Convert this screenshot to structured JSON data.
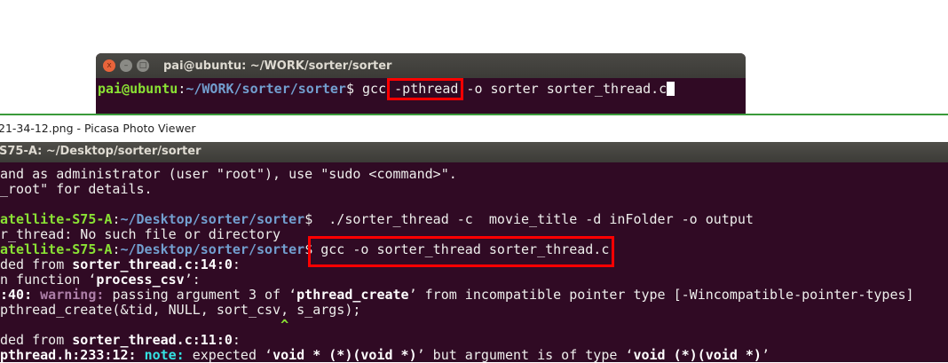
{
  "top_terminal": {
    "title": "pai@ubuntu: ~/WORK/sorter/sorter",
    "buttons": {
      "close": "x",
      "minimize": "–",
      "maximize": "□"
    },
    "prompt_user": "pai@ubuntu",
    "prompt_sep": ":",
    "prompt_path": "~/WORK/sorter/sorter",
    "prompt_end": "$ ",
    "command_pre": "gcc ",
    "command_highlight": "-pthread",
    "command_post": " -o sorter sorter_thread.c"
  },
  "picasa": {
    "title": "21-34-12.png - Picasa Photo Viewer"
  },
  "bottom_terminal": {
    "title": "S75-A: ~/Desktop/sorter/sorter",
    "lines": [
      [
        [
          "n",
          "and as administrator (user \"root\"), use \"sudo <command>\"."
        ]
      ],
      [
        [
          "n",
          "_root\" for details."
        ]
      ],
      [],
      [
        [
          "g",
          "atellite-S75-A"
        ],
        [
          "n",
          ":"
        ],
        [
          "b",
          "~/Desktop/sorter/sorter"
        ],
        [
          "n",
          "$  ./sorter_thread -c  movie_title -d inFolder -o output"
        ]
      ],
      [
        [
          "n",
          "r_thread: No such file or directory"
        ]
      ],
      [
        [
          "g",
          "atellite-S75-A"
        ],
        [
          "n",
          ":"
        ],
        [
          "b",
          "~/Desktop/sorter/sorter"
        ],
        [
          "n",
          "$ gcc -o sorter_thread sorter_thread.c"
        ]
      ],
      [
        [
          "n",
          "ded from "
        ],
        [
          "w",
          "sorter_thread.c:14:0"
        ],
        [
          "n",
          ":"
        ]
      ],
      [
        [
          "n",
          "n function ‘"
        ],
        [
          "w",
          "process_csv"
        ],
        [
          "n",
          "’:"
        ]
      ],
      [
        [
          "w",
          ":40: "
        ],
        [
          "m",
          "warning: "
        ],
        [
          "n",
          "passing argument 3 of ‘"
        ],
        [
          "w",
          "pthread_create"
        ],
        [
          "n",
          "’ from incompatible pointer type [-Wincompatible-pointer-types]"
        ]
      ],
      [
        [
          "n",
          "pthread_create(&tid, NULL, sort_csv, s_args);"
        ]
      ],
      [
        [
          "g",
          "                                   ^"
        ]
      ],
      [
        [
          "n",
          "ded from "
        ],
        [
          "w",
          "sorter_thread.c:11:0"
        ],
        [
          "n",
          ":"
        ]
      ],
      [
        [
          "w",
          "pthread.h:233:12: "
        ],
        [
          "c",
          "note: "
        ],
        [
          "n",
          "expected ‘"
        ],
        [
          "w",
          "void * (*)(void *)"
        ],
        [
          "n",
          "’ but argument is of type ‘"
        ],
        [
          "w",
          "void (*)(void *)"
        ],
        [
          "n",
          "’"
        ]
      ]
    ]
  },
  "colors": {
    "terminal_bg": "#300a24",
    "prompt_green": "#8ae234",
    "path_blue": "#729fcf",
    "highlight_red": "#ff0000",
    "warning_magenta": "#ad7fa8",
    "note_cyan": "#34e2e2"
  }
}
